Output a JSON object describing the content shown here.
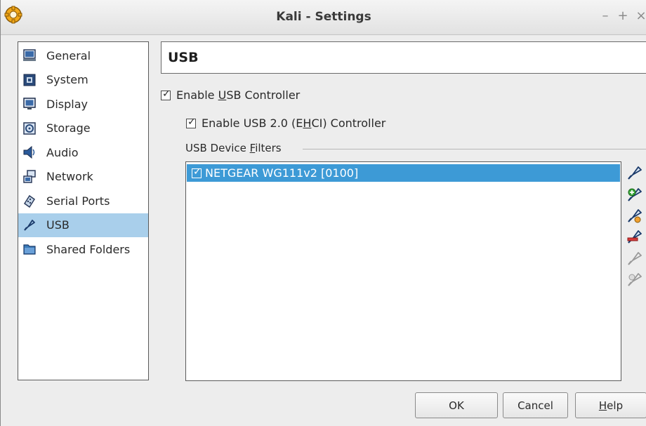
{
  "window": {
    "title": "Kali - Settings",
    "controls": {
      "minimize": "–",
      "maximize": "+",
      "close": "×"
    }
  },
  "sidebar": {
    "items": [
      {
        "label": "General",
        "icon": "general-icon",
        "selected": false
      },
      {
        "label": "System",
        "icon": "system-icon",
        "selected": false
      },
      {
        "label": "Display",
        "icon": "display-icon",
        "selected": false
      },
      {
        "label": "Storage",
        "icon": "storage-icon",
        "selected": false
      },
      {
        "label": "Audio",
        "icon": "audio-icon",
        "selected": false
      },
      {
        "label": "Network",
        "icon": "network-icon",
        "selected": false
      },
      {
        "label": "Serial Ports",
        "icon": "serial-ports-icon",
        "selected": false
      },
      {
        "label": "USB",
        "icon": "usb-icon",
        "selected": true
      },
      {
        "label": "Shared Folders",
        "icon": "shared-folders-icon",
        "selected": false
      }
    ]
  },
  "page": {
    "title": "USB",
    "enable_usb": {
      "pre": "Enable ",
      "mnemonic": "U",
      "post": "SB Controller",
      "checked": true
    },
    "enable_ehci": {
      "pre": "Enable USB 2.0 (E",
      "mnemonic": "H",
      "post": "CI) Controller",
      "checked": true
    },
    "filters_group": {
      "pre": "USB Device ",
      "mnemonic": "F",
      "post": "ilters"
    },
    "filters": [
      {
        "label": "NETGEAR WG111v2 [0100]",
        "checked": true,
        "selected": true
      }
    ],
    "toolbar": [
      "add-empty-filter-icon",
      "add-device-filter-icon",
      "edit-filter-icon",
      "remove-filter-icon",
      "move-filter-up-icon",
      "move-filter-down-icon"
    ]
  },
  "buttons": {
    "ok": "OK",
    "cancel": "Cancel",
    "help": {
      "mnemonic": "H",
      "post": "elp"
    }
  },
  "colors": {
    "selection": "#3d9ad6",
    "sidebar_selection": "#a9cfeb",
    "background": "#ededed"
  }
}
